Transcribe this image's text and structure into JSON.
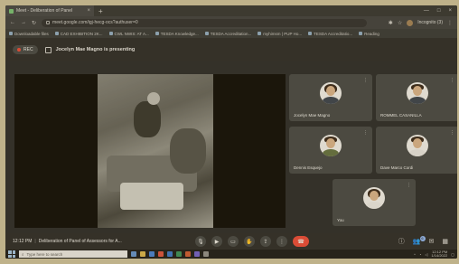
{
  "browser": {
    "tab_title": "Meet - Deliberation of Panel",
    "url": "meet.google.com/igj-hecg-ocs?authuser=0",
    "profile_name": "Incognito (3)"
  },
  "bookmarks": [
    "Downloadable files",
    "CAD EXHIBITION 2K...",
    "CWL NWIS: AT A...",
    "TESDA Knowledge...",
    "TESDA Accreditation...",
    "myhimsm | PUP Ho...",
    "TESDA Accreditatio...",
    "Reading"
  ],
  "meet": {
    "rec_label": "REC",
    "presenting_text": "Jocelyn Mae Magno is presenting",
    "meeting_time": "12:12 PM",
    "meeting_title": "Deliberation of Panel of Assessors for A...",
    "participants": [
      {
        "name": "Jocelyn Mae Magno"
      },
      {
        "name": "ROMMEL CASANILLA"
      },
      {
        "name": "Dennis Esquejo"
      },
      {
        "name": "Dave Marco Cordi"
      },
      {
        "name": "You"
      }
    ],
    "people_count": "6"
  },
  "taskbar": {
    "search_placeholder": "Type here to search",
    "clock_time": "12:12 PM",
    "clock_date": "1/14/2022"
  },
  "colors": {
    "meet_bg": "#202124",
    "tile_bg": "#3c4043",
    "leave_red": "#ea4335",
    "rec_dot": "#ea4335"
  }
}
